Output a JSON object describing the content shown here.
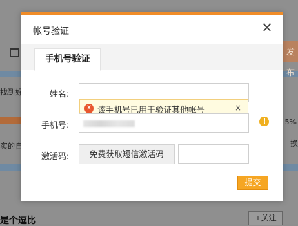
{
  "background": {
    "partial_texts": [
      "找到好",
      "实的自",
      "5%",
      "换"
    ],
    "right_button_label": "发布",
    "follow_button_label": "+关注",
    "bottom_title": "是个逗比"
  },
  "modal": {
    "title": "帐号验证",
    "close_label": "✕",
    "tab_label": "手机号验证",
    "fields": {
      "name_label": "姓名:",
      "phone_label": "手机号:",
      "code_label": "激活码:"
    },
    "tooltip": {
      "message": "该手机号已用于验证其他帐号",
      "close_label": "×"
    },
    "sms_button_label": "免费获取短信激活码",
    "submit_label": "提交"
  }
}
